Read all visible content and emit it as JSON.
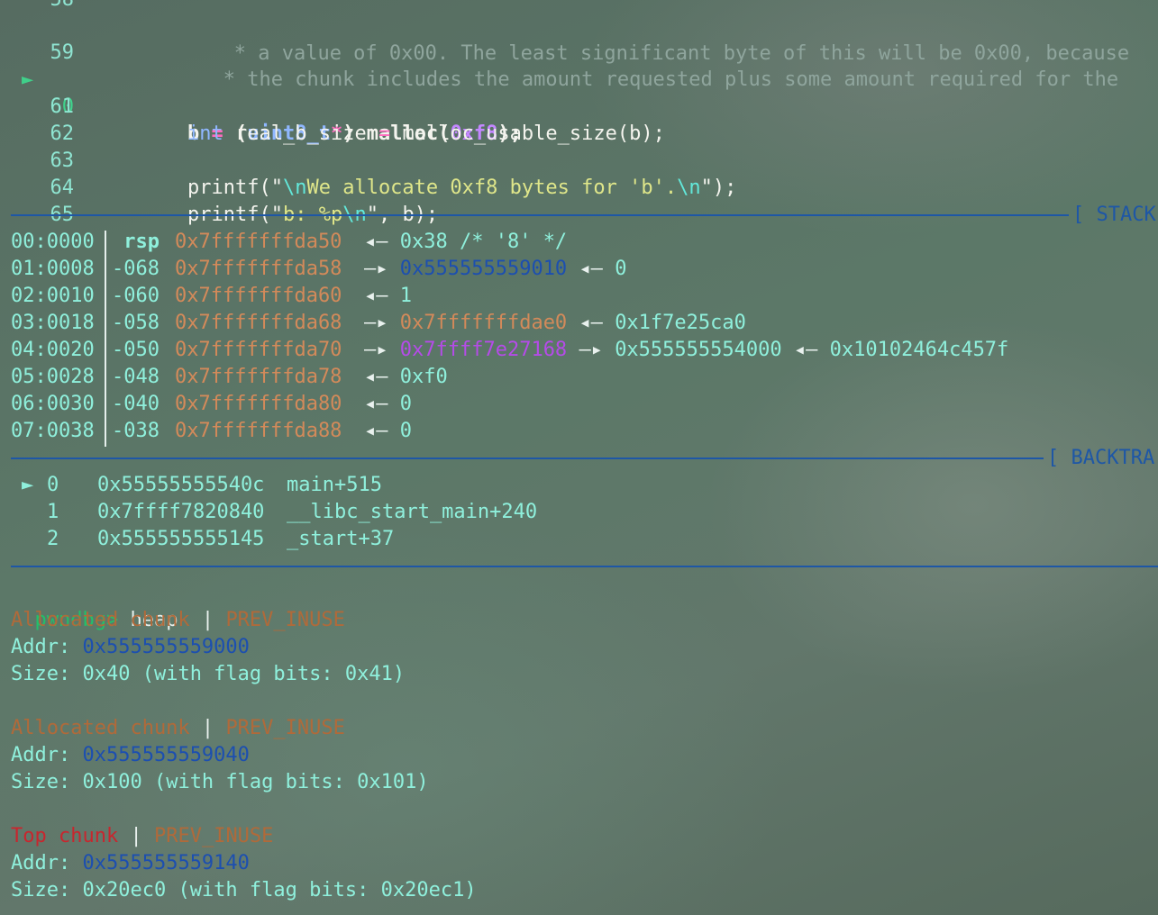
{
  "source": {
    "partial_top": {
      "number": "58",
      "comment": "   * a value of 0x00. The least significant byte of this will be 0x00, because"
    },
    "lines": [
      {
        "number": "59",
        "current": false,
        "kind": "comment",
        "text": "   * the chunk includes the amount requested plus some amount required for the"
      },
      {
        "number": "60",
        "current": true,
        "kind": "malloc",
        "lhs": "b",
        "eq": "=",
        "cast_open": "(",
        "cast_type": "uint8_t",
        "cast_star": "*",
        "cast_close": ")",
        "call": "malloc(",
        "arg": "0xf8",
        "close": ");"
      },
      {
        "number": "61",
        "current": false,
        "kind": "decl",
        "type": "int",
        "name": "real_b_size",
        "eq": "=",
        "rest": "malloc_usable_size(b);"
      },
      {
        "number": "62",
        "current": false,
        "kind": "blank"
      },
      {
        "number": "63",
        "current": false,
        "kind": "printf1",
        "pre": "printf(\"",
        "esc1": "\\n",
        "mid": "We allocate 0xf8 bytes for 'b'.",
        "esc2": "\\n",
        "post_q": "\"",
        "post": ");"
      },
      {
        "number": "64",
        "current": false,
        "kind": "printf2",
        "pre": "printf(\"",
        "mid": "b: %p",
        "esc": "\\n",
        "post_q": "\"",
        "post": ", b);"
      },
      {
        "number": "65",
        "current": false,
        "kind": "blank"
      }
    ],
    "current_marker": "►"
  },
  "stack": {
    "title": "[ STACK",
    "rows": [
      {
        "index": "00:0000",
        "offset": " rsp ",
        "addr": "0x7fffffffda50",
        "chain": [
          {
            "arrow": "◂—",
            "value": "0x38 /* '8' */",
            "style": "teal"
          }
        ]
      },
      {
        "index": "01:0008",
        "offset": "-068 ",
        "addr": "0x7fffffffda58",
        "chain": [
          {
            "arrow": "—▸",
            "value": "0x555555559010",
            "style": "blue"
          },
          {
            "arrow": "◂—",
            "value": "0",
            "style": "teal"
          }
        ]
      },
      {
        "index": "02:0010",
        "offset": "-060 ",
        "addr": "0x7fffffffda60",
        "chain": [
          {
            "arrow": "◂—",
            "value": "1",
            "style": "teal"
          }
        ]
      },
      {
        "index": "03:0018",
        "offset": "-058 ",
        "addr": "0x7fffffffda68",
        "chain": [
          {
            "arrow": "—▸",
            "value": "0x7fffffffdae0",
            "style": "addr"
          },
          {
            "arrow": "◂—",
            "value": "0x1f7e25ca0",
            "style": "teal"
          }
        ]
      },
      {
        "index": "04:0020",
        "offset": "-050 ",
        "addr": "0x7fffffffda70",
        "chain": [
          {
            "arrow": "—▸",
            "value": "0x7ffff7e27168",
            "style": "purple"
          },
          {
            "arrow": "—▸",
            "value": "0x555555554000",
            "style": "teal"
          },
          {
            "arrow": "◂—",
            "value": "0x10102464c457f",
            "style": "teal"
          }
        ]
      },
      {
        "index": "05:0028",
        "offset": "-048 ",
        "addr": "0x7fffffffda78",
        "chain": [
          {
            "arrow": "◂—",
            "value": "0xf0",
            "style": "teal"
          }
        ]
      },
      {
        "index": "06:0030",
        "offset": "-040 ",
        "addr": "0x7fffffffda80",
        "chain": [
          {
            "arrow": "◂—",
            "value": "0",
            "style": "teal"
          }
        ]
      },
      {
        "index": "07:0038",
        "offset": "-038 ",
        "addr": "0x7fffffffda88",
        "chain": [
          {
            "arrow": "◂—",
            "value": "0",
            "style": "teal"
          }
        ]
      }
    ]
  },
  "backtrace": {
    "title": "[ BACKTRA",
    "marker": "►",
    "frames": [
      {
        "num": "0",
        "addr": "0x55555555540c",
        "symbol": "main+515",
        "current": true
      },
      {
        "num": "1",
        "addr": "0x7ffff7820840",
        "symbol": "__libc_start_main+240",
        "current": false
      },
      {
        "num": "2",
        "addr": "0x555555555145",
        "symbol": "_start+37",
        "current": false
      }
    ]
  },
  "console": {
    "prompt": "pwndbg>",
    "command": "heap",
    "chunks": [
      {
        "type": "Allocated chunk",
        "type_color": "orange",
        "sep": " | ",
        "flag": "PREV_INUSE",
        "addr_label": "Addr: ",
        "addr": "0x555555559000",
        "size_label": "Size: ",
        "size": "0x40 (with flag bits: 0x41)"
      },
      {
        "type": "Allocated chunk",
        "type_color": "orange",
        "sep": " | ",
        "flag": "PREV_INUSE",
        "addr_label": "Addr: ",
        "addr": "0x555555559040",
        "size_label": "Size: ",
        "size": "0x100 (with flag bits: 0x101)"
      },
      {
        "type": "Top chunk",
        "type_color": "red",
        "sep": " | ",
        "flag": "PREV_INUSE",
        "addr_label": "Addr: ",
        "addr": "0x555555559140",
        "size_label": "Size: ",
        "size": "0x20ec0 (with flag bits: 0x20ec1)"
      }
    ]
  },
  "colors": {
    "background": "#5c7868",
    "separator": "#1e57a6",
    "line_number": "#8fe5d2",
    "stack_address": "#d38a5a",
    "heap_pointer": "#1c4fb0",
    "libc_pointer": "#b54be8",
    "prompt": "#23c06a",
    "top_chunk": "#c8262e"
  }
}
